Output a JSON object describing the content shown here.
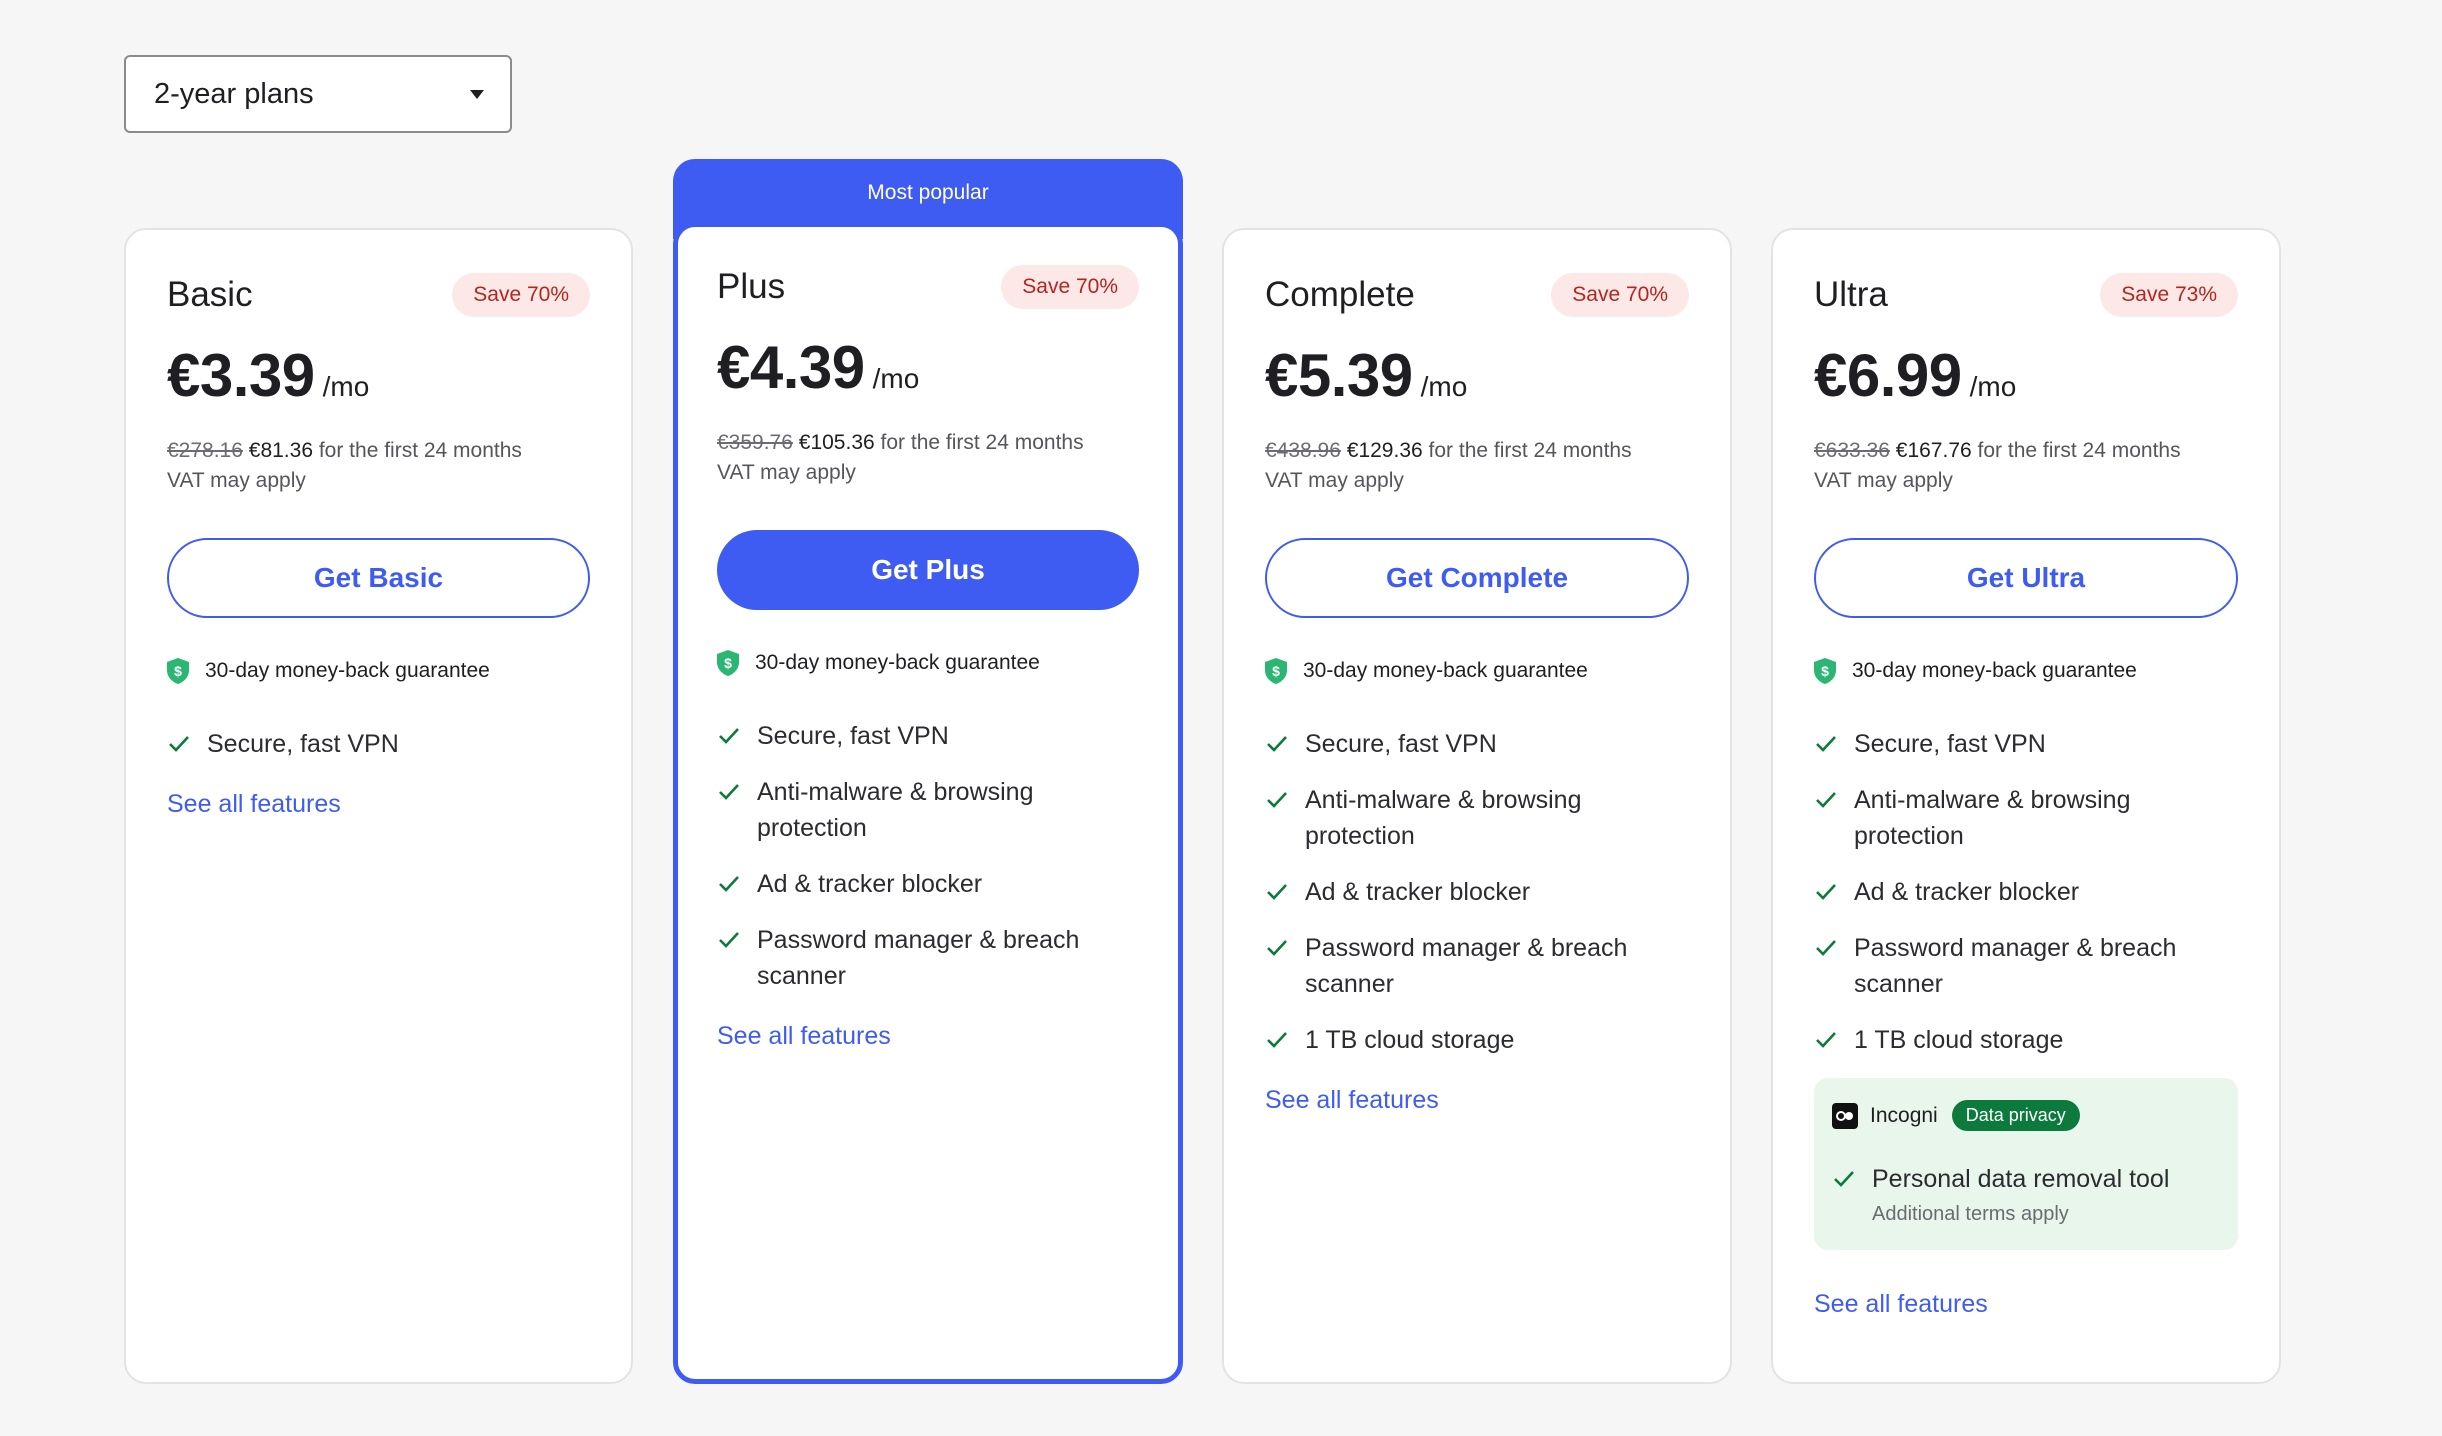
{
  "dropdown": {
    "label": "2-year plans"
  },
  "popular_banner": "Most popular",
  "colors": {
    "accent": "#3f5cf2",
    "save_badge_bg": "#fde8e8",
    "save_badge_text": "#b3261e",
    "check": "#0c7a3c",
    "incogni_bg": "#e8f6ec"
  },
  "plans": [
    {
      "name": "Basic",
      "save": "Save 70%",
      "price": "€3.39",
      "per": "/mo",
      "old_total": "€278.16",
      "new_total": "€81.36",
      "period": " for the first 24 months",
      "vat": "VAT may apply",
      "cta": "Get Basic",
      "guarantee": "30-day money-back guarantee",
      "features": [
        "Secure, fast VPN"
      ],
      "see_all": "See all features"
    },
    {
      "name": "Plus",
      "save": "Save 70%",
      "price": "€4.39",
      "per": "/mo",
      "old_total": "€359.76",
      "new_total": "€105.36",
      "period": " for the first 24 months",
      "vat": "VAT may apply",
      "cta": "Get Plus",
      "guarantee": "30-day money-back guarantee",
      "features": [
        "Secure, fast VPN",
        "Anti-malware & browsing protection",
        "Ad & tracker blocker",
        "Password manager & breach scanner"
      ],
      "see_all": "See all features"
    },
    {
      "name": "Complete",
      "save": "Save 70%",
      "price": "€5.39",
      "per": "/mo",
      "old_total": "€438.96",
      "new_total": "€129.36",
      "period": " for the first 24 months",
      "vat": "VAT may apply",
      "cta": "Get Complete",
      "guarantee": "30-day money-back guarantee",
      "features": [
        "Secure, fast VPN",
        "Anti-malware & browsing protection",
        "Ad & tracker blocker",
        "Password manager & breach scanner",
        "1 TB cloud storage"
      ],
      "see_all": "See all features"
    },
    {
      "name": "Ultra",
      "save": "Save 73%",
      "price": "€6.99",
      "per": "/mo",
      "old_total": "€633.36",
      "new_total": "€167.76",
      "period": " for the first 24 months",
      "vat": "VAT may apply",
      "cta": "Get Ultra",
      "guarantee": "30-day money-back guarantee",
      "features": [
        "Secure, fast VPN",
        "Anti-malware & browsing protection",
        "Ad & tracker blocker",
        "Password manager & breach scanner",
        "1 TB cloud storage"
      ],
      "incogni": {
        "brand": "Incogni",
        "tag": "Data privacy",
        "feature": "Personal data removal tool",
        "terms": "Additional terms apply"
      },
      "see_all": "See all features"
    }
  ]
}
